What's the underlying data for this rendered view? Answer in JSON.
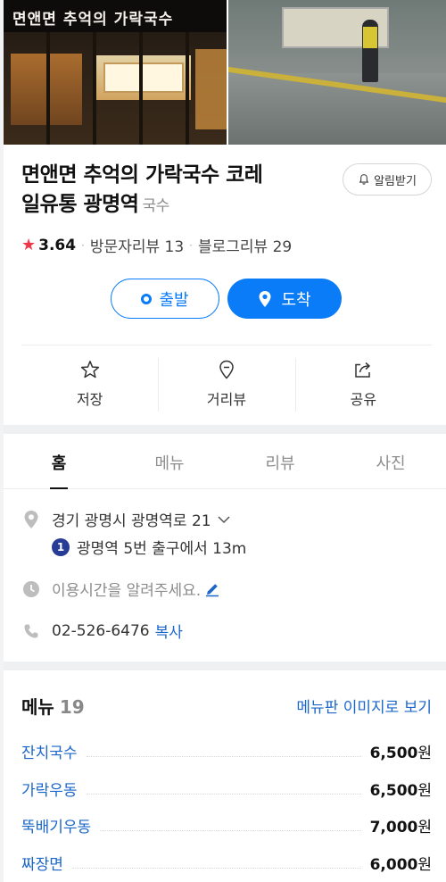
{
  "photos": {
    "sign_text": "면앤면 추억의 가락국수"
  },
  "place": {
    "name": "면앤면 추억의 가락국수 코레일유통 광명역",
    "name_line1": "면앤면 추억의 가락국수 코레",
    "name_line2": "일유통 광명역",
    "category": "국수",
    "alarm_label": "알림받기",
    "rating": "3.64",
    "visitor_reviews": "방문자리뷰 13",
    "blog_reviews": "블로그리뷰 29"
  },
  "route": {
    "depart_label": "출발",
    "arrive_label": "도착"
  },
  "actions": [
    {
      "label": "저장",
      "icon": "star-outline-icon"
    },
    {
      "label": "거리뷰",
      "icon": "street-view-pin-icon"
    },
    {
      "label": "공유",
      "icon": "share-icon"
    }
  ],
  "tabs": [
    {
      "label": "홈",
      "active": true
    },
    {
      "label": "메뉴",
      "active": false
    },
    {
      "label": "리뷰",
      "active": false
    },
    {
      "label": "사진",
      "active": false
    }
  ],
  "info": {
    "address": "경기 광명시 광명역로 21",
    "subway_line": "1",
    "subway_text": "광명역 5번 출구에서 13m",
    "hours_prompt": "이용시간을 알려주세요.",
    "phone": "02-526-6476",
    "copy_label": "복사"
  },
  "menu": {
    "title": "메뉴",
    "count": "19",
    "image_link": "메뉴판 이미지로 보기",
    "items": [
      {
        "name": "잔치국수",
        "price": "6,500",
        "unit": "원"
      },
      {
        "name": "가락우동",
        "price": "6,500",
        "unit": "원"
      },
      {
        "name": "뚝배기우동",
        "price": "7,000",
        "unit": "원"
      },
      {
        "name": "짜장면",
        "price": "6,000",
        "unit": "원"
      }
    ]
  },
  "colors": {
    "accent_blue": "#0a7cf7",
    "link_blue": "#1b66c9",
    "star_red": "#f0354b",
    "subway_line_1": "#263c96"
  }
}
